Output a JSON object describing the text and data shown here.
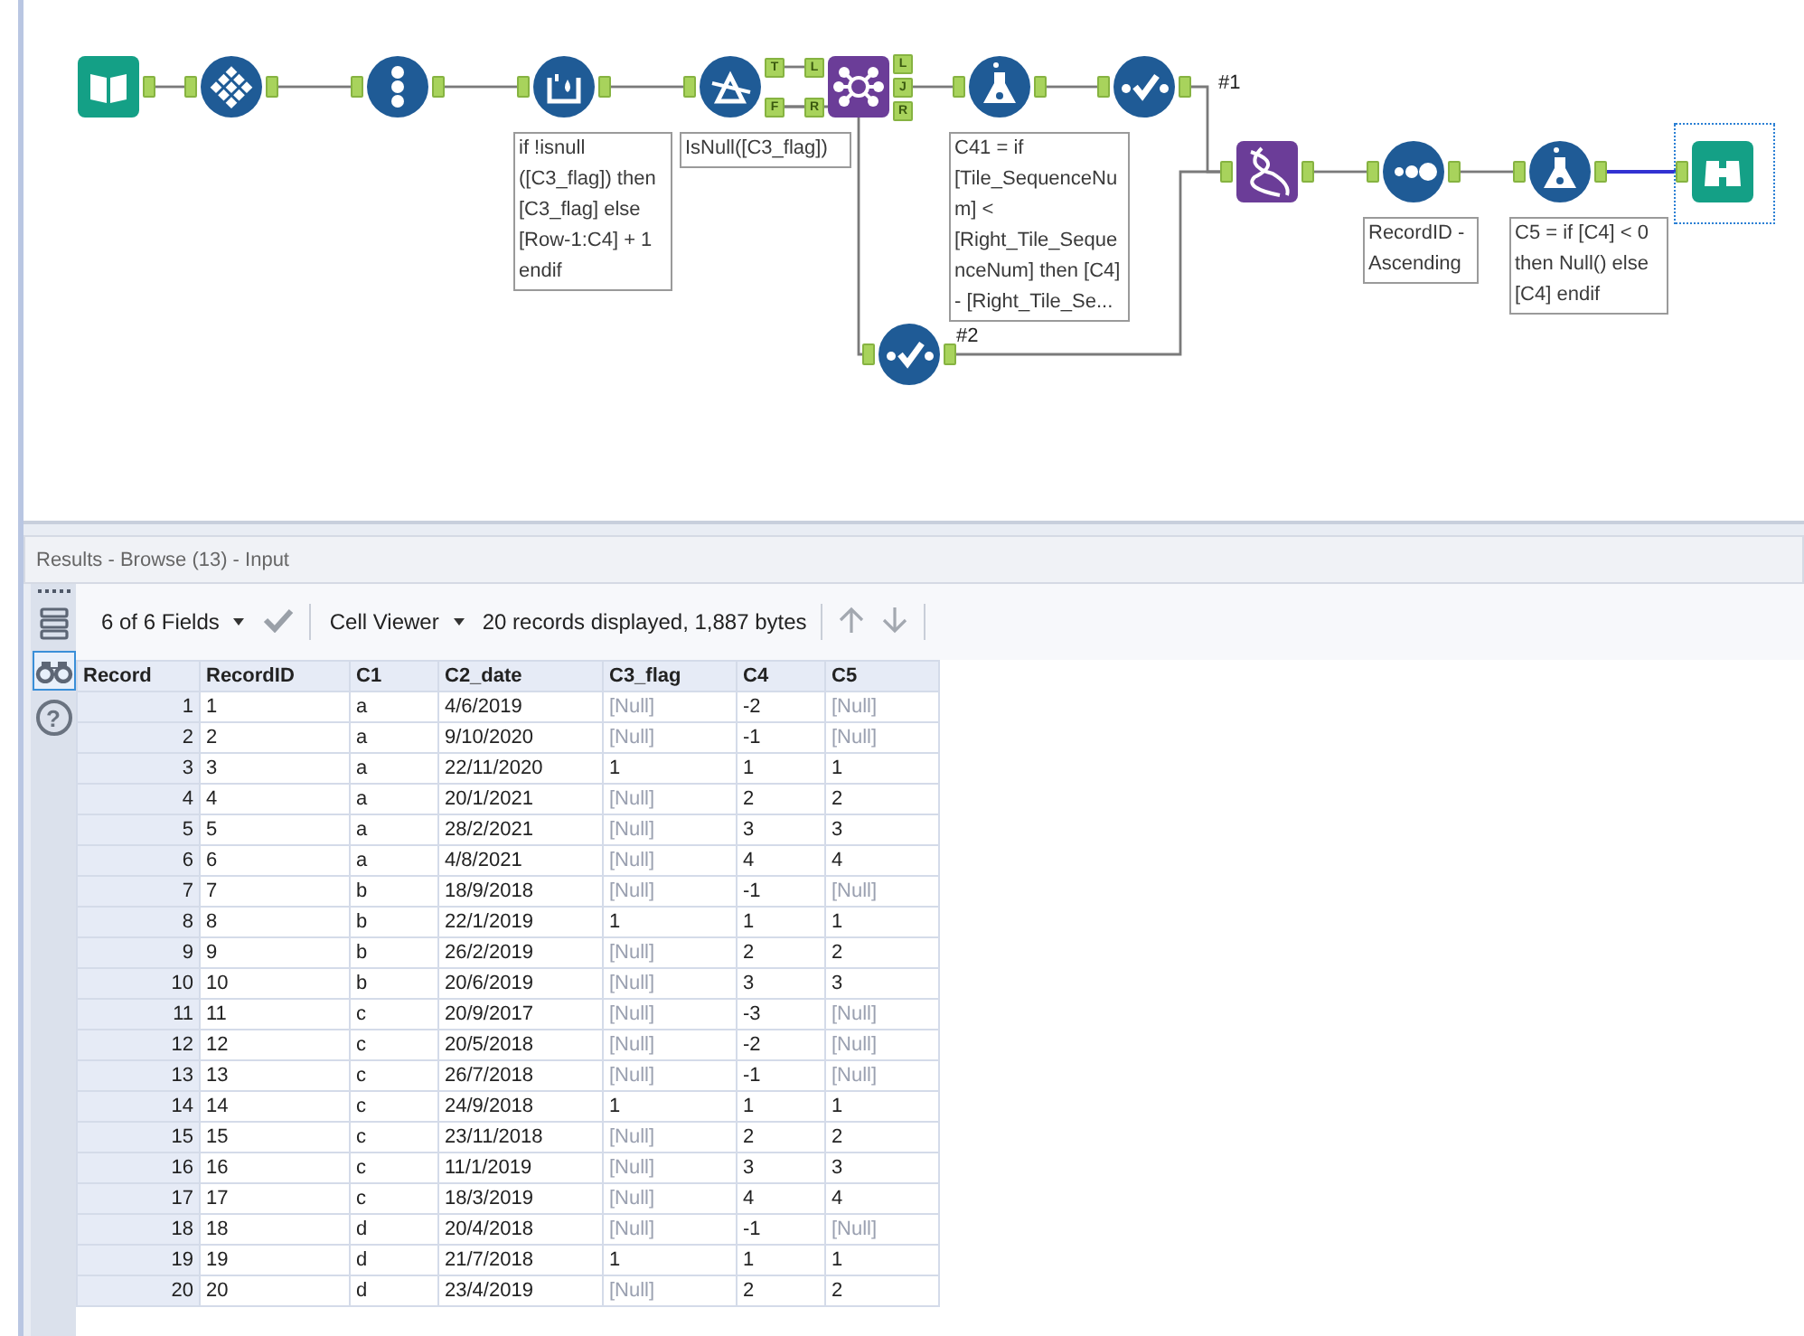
{
  "workflow": {
    "nodes": [
      {
        "kind": "input",
        "selected": false
      },
      {
        "kind": "record_id",
        "selected": false
      },
      {
        "kind": "multi_row",
        "selected": false
      },
      {
        "kind": "multi_row_formula",
        "selected": false,
        "annotation": "if !isnull ([C3_flag]) then [C3_flag] else [Row-1:C4] + 1 endif"
      },
      {
        "kind": "filter",
        "selected": false,
        "annotation": "IsNull([C3_flag])",
        "outputs": [
          "T",
          "F"
        ]
      },
      {
        "kind": "join",
        "selected": false,
        "inputs": [
          "L",
          "R"
        ],
        "outputs": [
          "L",
          "J",
          "R"
        ]
      },
      {
        "kind": "formula",
        "selected": false,
        "annotation": "C41 = if [Tile_SequenceNum] < [Right_Tile_SequenceNum] then [C4] - [Right_Tile_Se..."
      },
      {
        "kind": "select",
        "selected": false
      },
      {
        "kind": "select",
        "selected": false
      },
      {
        "kind": "union",
        "selected": false
      },
      {
        "kind": "sort",
        "selected": false,
        "annotation": "RecordID - Ascending"
      },
      {
        "kind": "formula",
        "selected": false,
        "annotation": "C5 = if [C4] < 0 then Null() else [C4] endif"
      },
      {
        "kind": "browse",
        "selected": true
      }
    ],
    "connections": [
      {
        "highlighted": false
      },
      {
        "highlighted": false
      },
      {
        "highlighted": false
      },
      {
        "highlighted": false
      },
      {
        "highlighted": false
      },
      {
        "highlighted": false
      },
      {
        "highlighted": false
      },
      {
        "highlighted": false
      },
      {
        "highlighted": false
      },
      {
        "label": "#1",
        "highlighted": false
      },
      {
        "label": "#2",
        "highlighted": false
      },
      {
        "highlighted": false
      },
      {
        "highlighted": false
      },
      {
        "highlighted": true
      }
    ]
  },
  "results": {
    "title": "Results - Browse (13) - Input",
    "views": [
      {
        "kind": "fields",
        "selected": false
      },
      {
        "kind": "browse",
        "selected": true
      },
      {
        "kind": "help",
        "glyph": "?",
        "selected": false
      }
    ],
    "toolbar": {
      "fields_menu": "6 of 6 Fields",
      "viewer_menu": "Cell Viewer",
      "status": "20 records displayed, 1,887 bytes"
    },
    "table": {
      "columns": [
        "Record",
        "RecordID",
        "C1",
        "C2_date",
        "C3_flag",
        "C4",
        "C5"
      ],
      "rows": [
        {
          "cells": [
            "1",
            "1",
            "a",
            "4/6/2019",
            {
              "text": "[Null]",
              "null": true
            },
            "-2",
            {
              "text": "[Null]",
              "null": true
            }
          ]
        },
        {
          "cells": [
            "2",
            "2",
            "a",
            "9/10/2020",
            {
              "text": "[Null]",
              "null": true
            },
            "-1",
            {
              "text": "[Null]",
              "null": true
            }
          ]
        },
        {
          "cells": [
            "3",
            "3",
            "a",
            "22/11/2020",
            "1",
            "1",
            "1"
          ]
        },
        {
          "cells": [
            "4",
            "4",
            "a",
            "20/1/2021",
            {
              "text": "[Null]",
              "null": true
            },
            "2",
            "2"
          ]
        },
        {
          "cells": [
            "5",
            "5",
            "a",
            "28/2/2021",
            {
              "text": "[Null]",
              "null": true
            },
            "3",
            "3"
          ]
        },
        {
          "cells": [
            "6",
            "6",
            "a",
            "4/8/2021",
            {
              "text": "[Null]",
              "null": true
            },
            "4",
            "4"
          ]
        },
        {
          "cells": [
            "7",
            "7",
            "b",
            "18/9/2018",
            {
              "text": "[Null]",
              "null": true
            },
            "-1",
            {
              "text": "[Null]",
              "null": true
            }
          ]
        },
        {
          "cells": [
            "8",
            "8",
            "b",
            "22/1/2019",
            "1",
            "1",
            "1"
          ]
        },
        {
          "cells": [
            "9",
            "9",
            "b",
            "26/2/2019",
            {
              "text": "[Null]",
              "null": true
            },
            "2",
            "2"
          ]
        },
        {
          "cells": [
            "10",
            "10",
            "b",
            "20/6/2019",
            {
              "text": "[Null]",
              "null": true
            },
            "3",
            "3"
          ]
        },
        {
          "cells": [
            "11",
            "11",
            "c",
            "20/9/2017",
            {
              "text": "[Null]",
              "null": true
            },
            "-3",
            {
              "text": "[Null]",
              "null": true
            }
          ]
        },
        {
          "cells": [
            "12",
            "12",
            "c",
            "20/5/2018",
            {
              "text": "[Null]",
              "null": true
            },
            "-2",
            {
              "text": "[Null]",
              "null": true
            }
          ]
        },
        {
          "cells": [
            "13",
            "13",
            "c",
            "26/7/2018",
            {
              "text": "[Null]",
              "null": true
            },
            "-1",
            {
              "text": "[Null]",
              "null": true
            }
          ]
        },
        {
          "cells": [
            "14",
            "14",
            "c",
            "24/9/2018",
            "1",
            "1",
            "1"
          ]
        },
        {
          "cells": [
            "15",
            "15",
            "c",
            "23/11/2018",
            {
              "text": "[Null]",
              "null": true
            },
            "2",
            "2"
          ]
        },
        {
          "cells": [
            "16",
            "16",
            "c",
            "11/1/2019",
            {
              "text": "[Null]",
              "null": true
            },
            "3",
            "3"
          ]
        },
        {
          "cells": [
            "17",
            "17",
            "c",
            "18/3/2019",
            {
              "text": "[Null]",
              "null": true
            },
            "4",
            "4"
          ]
        },
        {
          "cells": [
            "18",
            "18",
            "d",
            "20/4/2018",
            {
              "text": "[Null]",
              "null": true
            },
            "-1",
            {
              "text": "[Null]",
              "null": true
            }
          ]
        },
        {
          "cells": [
            "19",
            "19",
            "d",
            "21/7/2018",
            "1",
            "1",
            "1"
          ]
        },
        {
          "cells": [
            "20",
            "20",
            "d",
            "23/4/2019",
            {
              "text": "[Null]",
              "null": true
            },
            "2",
            "2"
          ]
        }
      ]
    }
  }
}
